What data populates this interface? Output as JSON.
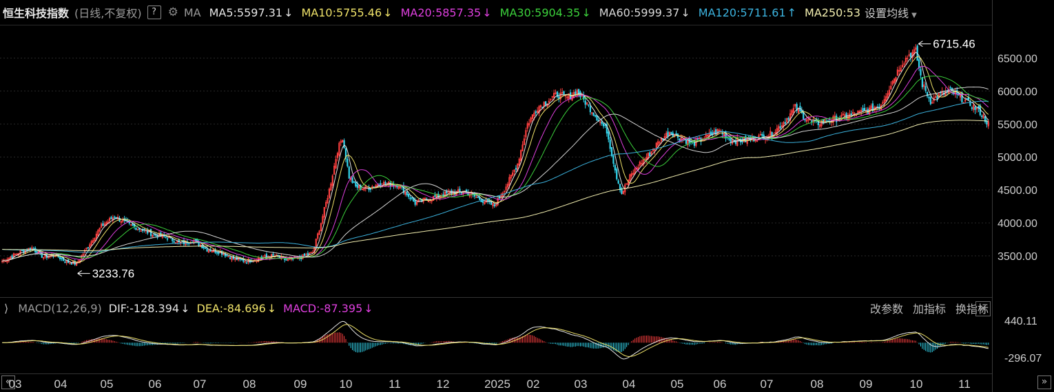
{
  "header": {
    "title": "恒生科技指数",
    "subtitle": "(日线,不复权)",
    "help_label": "?",
    "ma_label": "MA",
    "ma_items": [
      {
        "text": "MA5:5597.31",
        "arrow": "↓",
        "color": "#e6e6e6"
      },
      {
        "text": "MA10:5755.46",
        "arrow": "↓",
        "color": "#f0e36a"
      },
      {
        "text": "MA20:5857.35",
        "arrow": "↓",
        "color": "#e040e0"
      },
      {
        "text": "MA30:5904.35",
        "arrow": "↓",
        "color": "#3cd23c"
      },
      {
        "text": "MA60:5999.37",
        "arrow": "↓",
        "color": "#d8d8d8"
      },
      {
        "text": "MA120:5711.61",
        "arrow": "↑",
        "color": "#3cb4e0"
      },
      {
        "text": "MA250:53",
        "arrow": "",
        "color": "#f3efb0"
      }
    ],
    "settings_label": "设置均线"
  },
  "macd_panel": {
    "label": "MACD(12,26,9)",
    "dif": "DIF:-128.394",
    "dif_arrow": "↓",
    "dea": "DEA:-84.696",
    "dea_arrow": "↓",
    "macd": "MACD:-87.395",
    "macd_arrow": "↓",
    "buttons": [
      "改参数",
      "加指标",
      "换指标"
    ],
    "close_label": "✕"
  },
  "nav": {
    "left": "«",
    "right": "»"
  },
  "colors": {
    "up": "#ff4040",
    "down": "#33d6ee",
    "grid": "#2a2a2a",
    "axis_text": "#cfcfcf"
  },
  "chart_data": [
    {
      "type": "candlestick",
      "title": "恒生科技指数",
      "ylim": [
        3000,
        6900
      ],
      "y_ticks": [
        "6500.00",
        "6000.00",
        "5500.00",
        "5000.00",
        "4500.00",
        "4000.00",
        "3500.00"
      ],
      "y_tick_values": [
        6500,
        6000,
        5500,
        5000,
        4500,
        4000,
        3500
      ],
      "x_ticks": [
        "03",
        "04",
        "05",
        "06",
        "07",
        "08",
        "09",
        "10",
        "11",
        "12",
        "2025",
        "02",
        "03",
        "04",
        "05",
        "06",
        "07",
        "08",
        "09",
        "10",
        "11"
      ],
      "annotations": [
        {
          "label": "6715.46",
          "value": 6715.46,
          "kind": "high"
        },
        {
          "label": "3233.76",
          "value": 3233.76,
          "kind": "low"
        }
      ],
      "close_keypoints": [
        [
          0,
          3420
        ],
        [
          10,
          3550
        ],
        [
          18,
          3620
        ],
        [
          25,
          3480
        ],
        [
          32,
          3520
        ],
        [
          38,
          3420
        ],
        [
          45,
          3380
        ],
        [
          52,
          3650
        ],
        [
          60,
          3950
        ],
        [
          68,
          4100
        ],
        [
          76,
          3980
        ],
        [
          84,
          3900
        ],
        [
          92,
          3820
        ],
        [
          100,
          3780
        ],
        [
          108,
          3690
        ],
        [
          116,
          3730
        ],
        [
          124,
          3600
        ],
        [
          132,
          3560
        ],
        [
          140,
          3460
        ],
        [
          148,
          3420
        ],
        [
          156,
          3470
        ],
        [
          164,
          3500
        ],
        [
          172,
          3440
        ],
        [
          180,
          3470
        ],
        [
          188,
          3550
        ],
        [
          193,
          4000
        ],
        [
          198,
          4500
        ],
        [
          203,
          5100
        ],
        [
          206,
          5300
        ],
        [
          210,
          4700
        ],
        [
          214,
          4550
        ],
        [
          220,
          4520
        ],
        [
          230,
          4600
        ],
        [
          240,
          4580
        ],
        [
          250,
          4300
        ],
        [
          260,
          4380
        ],
        [
          270,
          4450
        ],
        [
          280,
          4480
        ],
        [
          290,
          4350
        ],
        [
          298,
          4260
        ],
        [
          306,
          4600
        ],
        [
          312,
          4900
        ],
        [
          318,
          5500
        ],
        [
          324,
          5750
        ],
        [
          330,
          5850
        ],
        [
          336,
          5950
        ],
        [
          342,
          5900
        ],
        [
          348,
          6000
        ],
        [
          354,
          5800
        ],
        [
          360,
          5600
        ],
        [
          366,
          5400
        ],
        [
          372,
          4700
        ],
        [
          375,
          4450
        ],
        [
          380,
          4700
        ],
        [
          386,
          4900
        ],
        [
          392,
          5050
        ],
        [
          398,
          5250
        ],
        [
          404,
          5380
        ],
        [
          410,
          5300
        ],
        [
          418,
          5200
        ],
        [
          426,
          5300
        ],
        [
          434,
          5400
        ],
        [
          442,
          5250
        ],
        [
          450,
          5250
        ],
        [
          458,
          5300
        ],
        [
          466,
          5350
        ],
        [
          474,
          5550
        ],
        [
          480,
          5750
        ],
        [
          486,
          5600
        ],
        [
          492,
          5500
        ],
        [
          500,
          5550
        ],
        [
          508,
          5600
        ],
        [
          516,
          5650
        ],
        [
          524,
          5700
        ],
        [
          532,
          5800
        ],
        [
          538,
          6100
        ],
        [
          544,
          6400
        ],
        [
          549,
          6550
        ],
        [
          553,
          6600
        ],
        [
          557,
          6100
        ],
        [
          562,
          5850
        ],
        [
          568,
          5950
        ],
        [
          574,
          6000
        ],
        [
          580,
          5900
        ],
        [
          586,
          5800
        ],
        [
          592,
          5680
        ],
        [
          597,
          5500
        ]
      ],
      "ma_series": [
        {
          "name": "MA5",
          "period": 5,
          "color": "#e6e6e6"
        },
        {
          "name": "MA10",
          "period": 10,
          "color": "#f0e36a"
        },
        {
          "name": "MA20",
          "period": 20,
          "color": "#e040e0"
        },
        {
          "name": "MA30",
          "period": 30,
          "color": "#3cd23c"
        },
        {
          "name": "MA60",
          "period": 60,
          "color": "#d8d8d8"
        },
        {
          "name": "MA120",
          "period": 120,
          "color": "#3cb4e0"
        },
        {
          "name": "MA250",
          "period": 250,
          "color": "#f3efb0"
        }
      ]
    },
    {
      "type": "bar",
      "title": "MACD(12,26,9)",
      "ylim": [
        -296.07,
        440.11
      ],
      "y_ticks": [
        "440.11",
        "-296.07"
      ],
      "y_tick_values": [
        440.11,
        -296.07
      ],
      "series": [
        {
          "name": "DIF",
          "latest": -128.394
        },
        {
          "name": "DEA",
          "latest": -84.696
        },
        {
          "name": "MACD",
          "latest": -87.395
        }
      ]
    }
  ]
}
